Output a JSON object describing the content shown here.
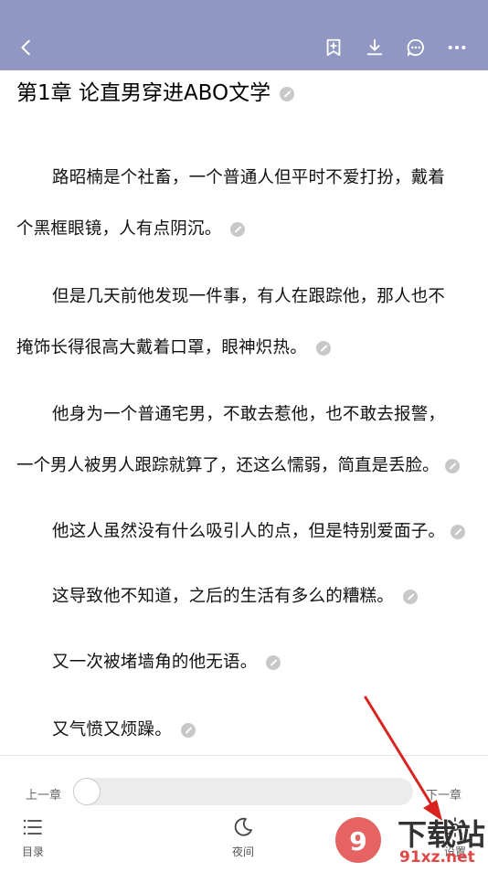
{
  "title": "第1章 论直男穿进ABO文学",
  "paragraphs": [
    {
      "line1": "路昭楠是个社畜，一个普通人但平时不爱打扮，戴着",
      "line2": "个黑框眼镜，人有点阴沉。"
    },
    {
      "line1": "但是几天前他发现一件事，有人在跟踪他，那人也不",
      "line2": "掩饰长得很高大戴着口罩，眼神炽热。"
    },
    {
      "line1": "他身为一个普通宅男，不敢去惹他，也不敢去报警，",
      "line2": "一个男人被男人跟踪就算了，还这么懦弱，简直是丢脸。"
    },
    {
      "line1": "他这人虽然没有什么吸引人的点，但是特别爱面子。"
    },
    {
      "line1": "这导致他不知道，之后的生活有多么的糟糕。"
    },
    {
      "line1": "又一次被堵墙角的他无语。"
    },
    {
      "line1": "又气愤又烦躁。"
    }
  ],
  "reader": {
    "prev_chapter": "上一章",
    "next_chapter": "下一章",
    "progress": 0.0
  },
  "bottom_nav": {
    "catalog": "目录",
    "night": "夜间",
    "settings": "设置"
  },
  "watermark": {
    "text1": "下载站",
    "text2": "91xz.net"
  },
  "colors": {
    "topbar": "#8f97c2",
    "arrow": "#d9231e"
  }
}
